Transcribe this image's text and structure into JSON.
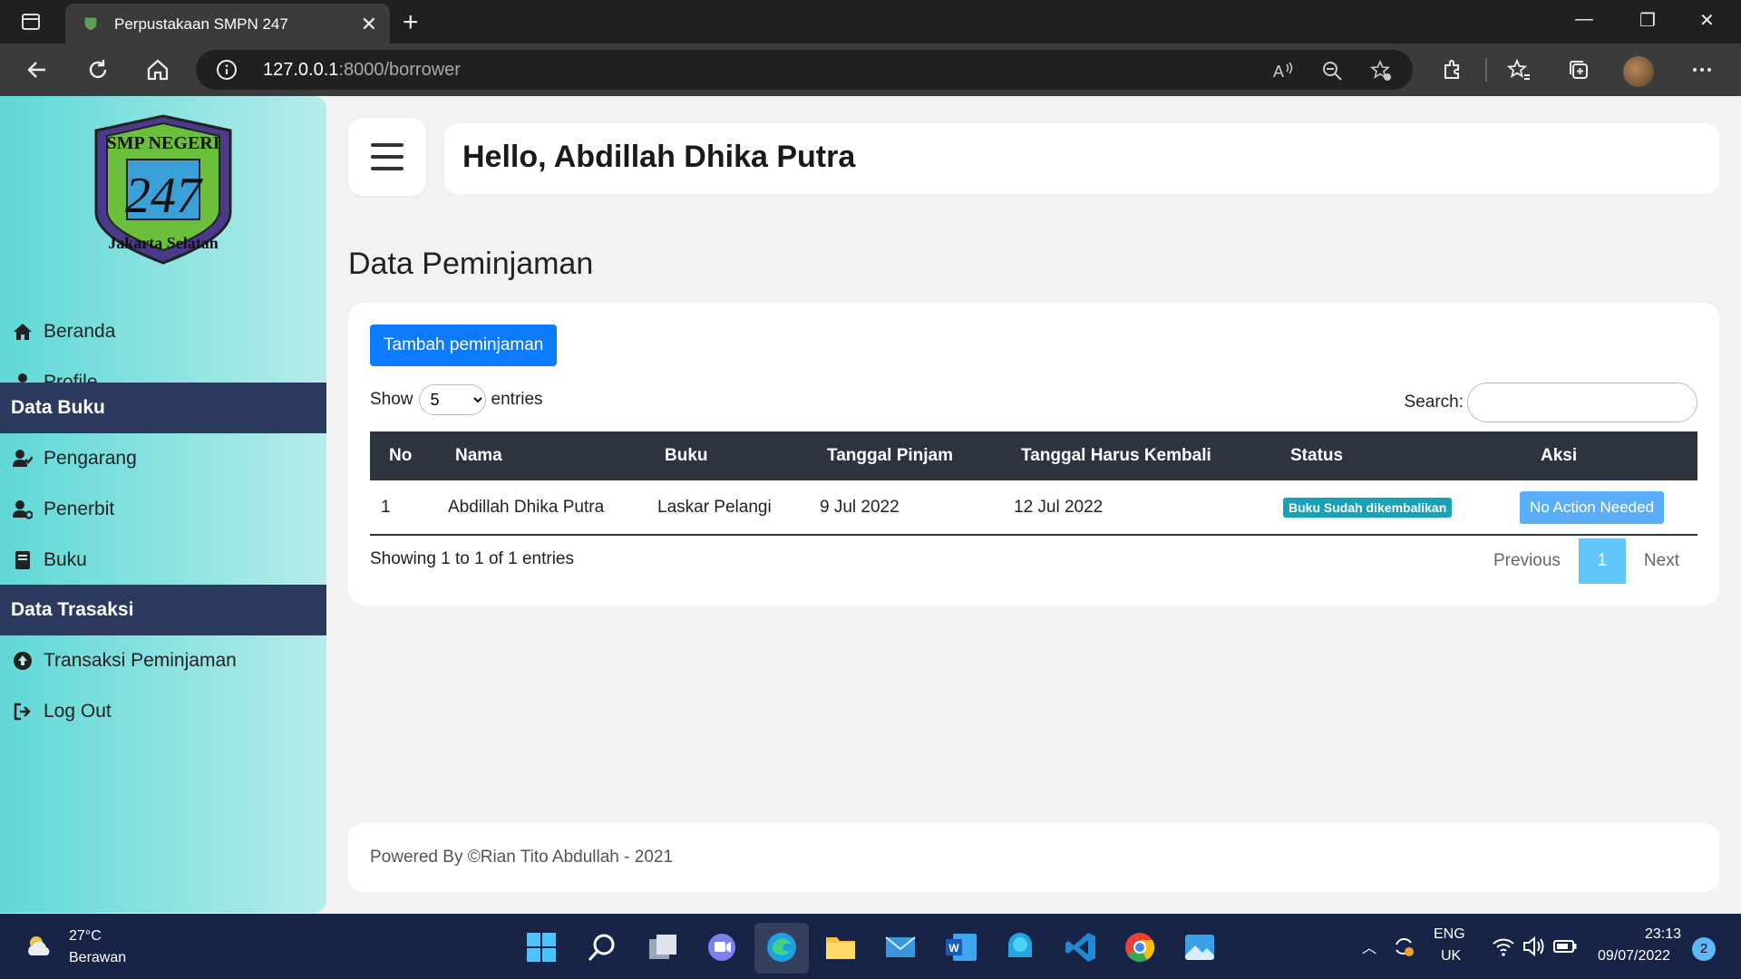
{
  "browser": {
    "tab_title": "Perpustakaan SMPN 247",
    "url_host": "127.0.0.1",
    "url_path": ":8000/borrower"
  },
  "sidebar": {
    "items_top": [
      {
        "label": "Beranda",
        "icon": "home-icon"
      },
      {
        "label": "Profile",
        "icon": "user-icon"
      }
    ],
    "section_books": "Data Buku",
    "items_books": [
      {
        "label": "Pengarang",
        "icon": "user-check-icon"
      },
      {
        "label": "Penerbit",
        "icon": "user-gear-icon"
      },
      {
        "label": "Buku",
        "icon": "book-icon"
      }
    ],
    "section_trans": "Data Trasaksi",
    "items_trans": [
      {
        "label": "Transaksi Peminjaman",
        "icon": "arrow-circle-up-icon"
      },
      {
        "label": "Log Out",
        "icon": "sign-out-icon"
      }
    ]
  },
  "header": {
    "greeting": "Hello, Abdillah Dhika Putra"
  },
  "main": {
    "title": "Data Peminjaman",
    "add_button": "Tambah peminjaman",
    "show_label": "Show",
    "entries_label": "entries",
    "page_size": "5",
    "search_label": "Search:",
    "columns": [
      "No",
      "Nama",
      "Buku",
      "Tanggal Pinjam",
      "Tanggal Harus Kembali",
      "Status",
      "Aksi"
    ],
    "rows": [
      {
        "no": "1",
        "nama": "Abdillah Dhika Putra",
        "buku": "Laskar Pelangi",
        "pinjam": "9 Jul 2022",
        "kembali": "12 Jul 2022",
        "status": "Buku Sudah dikembalikan",
        "aksi": "No Action Needed"
      }
    ],
    "showing": "Showing 1 to 1 of 1 entries",
    "pager": {
      "prev": "Previous",
      "current": "1",
      "next": "Next"
    }
  },
  "footer": {
    "text": "Powered By ©Rian Tito Abdullah - 2021"
  },
  "logo": {
    "top": "SMP NEGERI",
    "number": "247",
    "bottom": "Jakarta Selatan"
  },
  "taskbar": {
    "temp": "27°C",
    "weather": "Berawan",
    "lang1": "ENG",
    "lang2": "UK",
    "time": "23:13",
    "date": "09/07/2022",
    "notifications": "2"
  },
  "colors": {
    "sidebar_head": "#2b3a5e",
    "primary": "#0d7bff",
    "badge": "#17a2b8",
    "taskbar": "#182447"
  }
}
